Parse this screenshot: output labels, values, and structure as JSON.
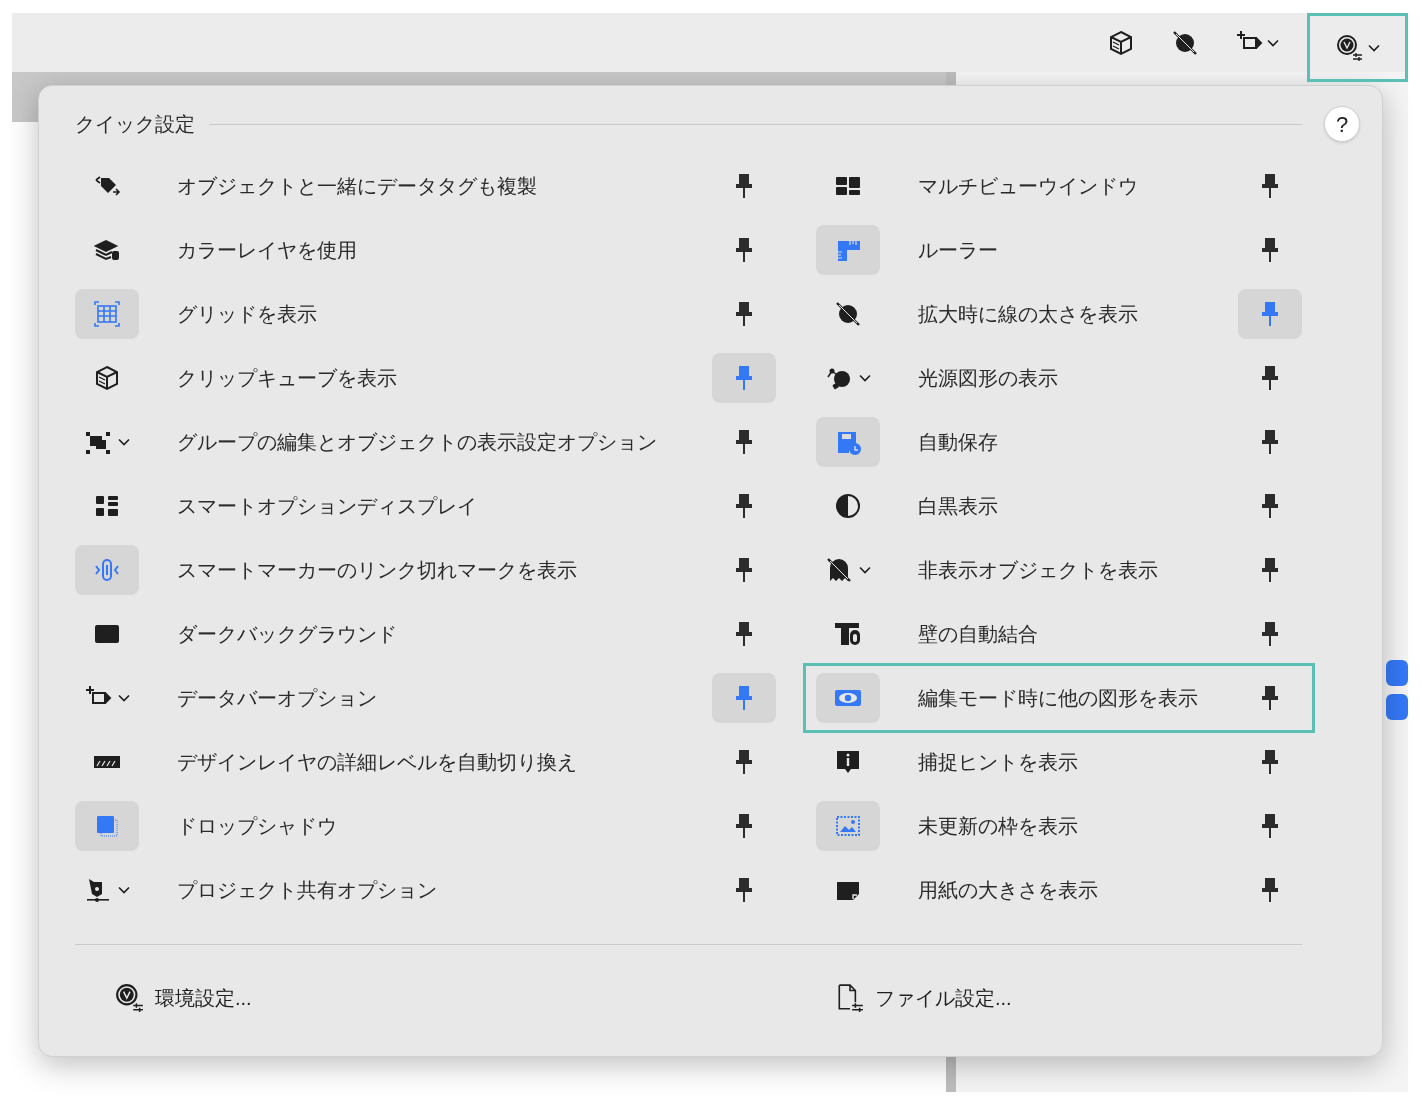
{
  "toolbar": {
    "buttons": [
      {
        "kind": "cube",
        "dropdown": false,
        "outlined": false
      },
      {
        "kind": "line-thickness",
        "dropdown": false,
        "outlined": false
      },
      {
        "kind": "databar",
        "dropdown": true,
        "outlined": false
      },
      {
        "kind": "prefs",
        "dropdown": true,
        "outlined": true
      }
    ]
  },
  "quick_settings": {
    "title": "クイック設定",
    "help": "?",
    "left_items": [
      {
        "kind": "tag-duplicate",
        "label": "オブジェクトと一緒にデータタグも複製",
        "active": false,
        "dropdown": false,
        "pinned": false,
        "outlined": false
      },
      {
        "kind": "layers",
        "label": "カラーレイヤを使用",
        "active": false,
        "dropdown": false,
        "pinned": false,
        "outlined": false
      },
      {
        "kind": "grid",
        "label": "グリッドを表示",
        "active": true,
        "dropdown": false,
        "pinned": false,
        "outlined": false
      },
      {
        "kind": "cube",
        "label": "クリップキューブを表示",
        "active": false,
        "dropdown": false,
        "pinned": true,
        "outlined": false
      },
      {
        "kind": "group",
        "label": "グループの編集とオブジェクトの表示設定オプション",
        "active": false,
        "dropdown": true,
        "pinned": false,
        "outlined": false
      },
      {
        "kind": "smart-options",
        "label": "スマートオプションディスプレイ",
        "active": false,
        "dropdown": false,
        "pinned": false,
        "outlined": false
      },
      {
        "kind": "link",
        "label": "スマートマーカーのリンク切れマークを表示",
        "active": true,
        "dropdown": false,
        "pinned": false,
        "outlined": false
      },
      {
        "kind": "dark-background",
        "label": "ダークバックグラウンド",
        "active": false,
        "dropdown": false,
        "pinned": false,
        "outlined": false
      },
      {
        "kind": "databar",
        "label": "データバーオプション",
        "active": false,
        "dropdown": true,
        "pinned": true,
        "outlined": false
      },
      {
        "kind": "design-layer",
        "label": "デザインレイヤの詳細レベルを自動切り換え",
        "active": false,
        "dropdown": false,
        "pinned": false,
        "outlined": false
      },
      {
        "kind": "drop-shadow",
        "label": "ドロップシャドウ",
        "active": true,
        "dropdown": false,
        "pinned": false,
        "outlined": false
      },
      {
        "kind": "project-share",
        "label": "プロジェクト共有オプション",
        "active": false,
        "dropdown": true,
        "pinned": false,
        "outlined": false
      }
    ],
    "right_items": [
      {
        "kind": "multiview",
        "label": "マルチビューウインドウ",
        "active": false,
        "dropdown": false,
        "pinned": false,
        "outlined": false
      },
      {
        "kind": "ruler",
        "label": "ルーラー",
        "active": true,
        "dropdown": false,
        "pinned": false,
        "outlined": false
      },
      {
        "kind": "line-thickness",
        "label": "拡大時に線の太さを表示",
        "active": false,
        "dropdown": false,
        "pinned": true,
        "outlined": false
      },
      {
        "kind": "light",
        "label": "光源図形の表示",
        "active": false,
        "dropdown": true,
        "pinned": false,
        "outlined": false
      },
      {
        "kind": "autosave",
        "label": "自動保存",
        "active": true,
        "dropdown": false,
        "pinned": false,
        "outlined": false
      },
      {
        "kind": "grayscale",
        "label": "白黒表示",
        "active": false,
        "dropdown": false,
        "pinned": false,
        "outlined": false
      },
      {
        "kind": "ghost",
        "label": "非表示オブジェクトを表示",
        "active": false,
        "dropdown": true,
        "pinned": false,
        "outlined": false
      },
      {
        "kind": "wall",
        "label": "壁の自動結合",
        "active": false,
        "dropdown": false,
        "pinned": false,
        "outlined": false
      },
      {
        "kind": "eye",
        "label": "編集モード時に他の図形を表示",
        "active": true,
        "dropdown": false,
        "pinned": false,
        "outlined": true
      },
      {
        "kind": "info",
        "label": "捕捉ヒントを表示",
        "active": false,
        "dropdown": false,
        "pinned": false,
        "outlined": false
      },
      {
        "kind": "frame",
        "label": "未更新の枠を表示",
        "active": true,
        "dropdown": false,
        "pinned": false,
        "outlined": false
      },
      {
        "kind": "paper",
        "label": "用紙の大きさを表示",
        "active": false,
        "dropdown": false,
        "pinned": false,
        "outlined": false
      }
    ],
    "footer": [
      {
        "kind": "prefs",
        "label": "環境設定..."
      },
      {
        "kind": "file",
        "label": "ファイル設定..."
      }
    ]
  }
}
